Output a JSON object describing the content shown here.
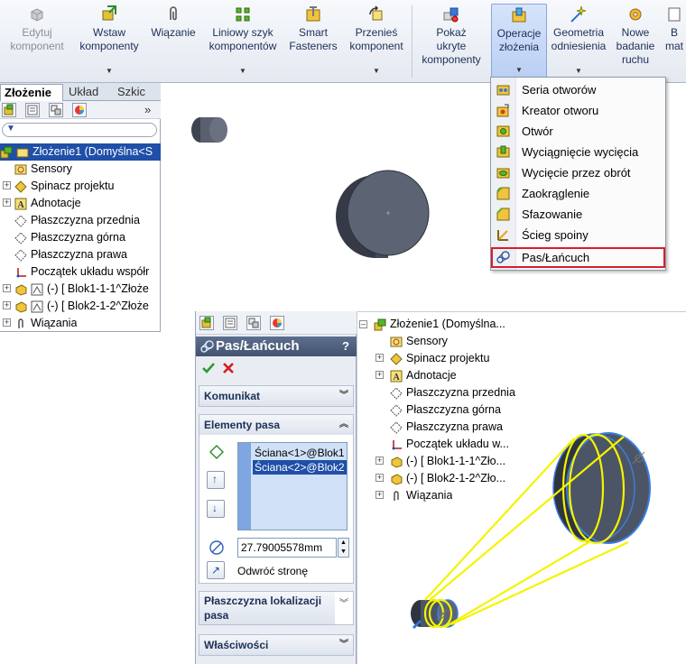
{
  "ribbon": {
    "buttons": [
      {
        "label1": "Edytuj",
        "label2": "komponent",
        "icon": "edit-component-icon",
        "disabled": true
      },
      {
        "label1": "Wstaw",
        "label2": "komponenty",
        "icon": "insert-components-icon"
      },
      {
        "label1": "Wiązanie",
        "label2": "",
        "icon": "mate-icon"
      },
      {
        "label1": "Liniowy szyk",
        "label2": "komponentów",
        "icon": "linear-pattern-icon"
      },
      {
        "label1": "Smart",
        "label2": "Fasteners",
        "icon": "smart-fasteners-icon"
      },
      {
        "label1": "Przenieś",
        "label2": "komponent",
        "icon": "move-component-icon"
      },
      {
        "label1": "Pokaż",
        "label2": "ukryte",
        "label3": "komponenty",
        "icon": "show-hidden-icon"
      },
      {
        "label1": "Operacje",
        "label2": "złożenia",
        "icon": "assembly-features-icon"
      },
      {
        "label1": "Geometria",
        "label2": "odniesienia",
        "icon": "reference-geometry-icon"
      },
      {
        "label1": "Nowe",
        "label2": "badanie",
        "label3": "ruchu",
        "icon": "new-motion-study-icon"
      },
      {
        "label1": "B",
        "label2": "mat",
        "icon": "bill-of-materials-icon"
      }
    ]
  },
  "left_panel": {
    "tabs": [
      "Złożenie",
      "Układ",
      "Szkic"
    ],
    "expand_glyph": "»",
    "tree": [
      {
        "label": "Złożenie1  (Domyślna<S",
        "selected": true
      },
      {
        "label": "Sensory"
      },
      {
        "label": "Spinacz projektu"
      },
      {
        "label": "Adnotacje"
      },
      {
        "label": "Płaszczyzna przednia"
      },
      {
        "label": "Płaszczyzna górna"
      },
      {
        "label": "Płaszczyzna prawa"
      },
      {
        "label": "Początek układu współr"
      },
      {
        "label": "(-) [ Blok1-1-1^Złoże"
      },
      {
        "label": "(-) [ Blok2-1-2^Złoże"
      },
      {
        "label": "Wiązania"
      }
    ]
  },
  "dropdown_menu": {
    "items": [
      {
        "label": "Seria otworów",
        "icon": "hole-series-icon"
      },
      {
        "label": "Kreator otworu",
        "icon": "hole-wizard-icon"
      },
      {
        "label": "Otwór",
        "icon": "hole-icon"
      },
      {
        "label": "Wyciągnięcie wycięcia",
        "icon": "extruded-cut-icon"
      },
      {
        "label": "Wycięcie przez obrót",
        "icon": "revolved-cut-icon"
      },
      {
        "label": "Zaokrąglenie",
        "icon": "fillet-icon"
      },
      {
        "label": "Sfazowanie",
        "icon": "chamfer-icon"
      },
      {
        "label": "Ścieg spoiny",
        "icon": "weld-bead-icon"
      },
      {
        "label": "Pas/Łańcuch",
        "icon": "belt-chain-icon",
        "highlighted": true
      }
    ]
  },
  "property_manager": {
    "title": "Pas/Łańcuch",
    "help": "?",
    "groups": {
      "message": "Komunikat",
      "belt_members": "Elementy pasa",
      "belt_plane": "Płaszczyzna lokalizacji pasa",
      "properties": "Właściwości"
    },
    "belt_items": [
      "Ściana<1>@Blok1",
      "Ściana<2>@Blok2"
    ],
    "length_value": "27.79005578mm",
    "reverse_label": "Odwróć stronę"
  },
  "right_tree": [
    {
      "label": "Złożenie1  (Domyślna..."
    },
    {
      "label": "Sensory"
    },
    {
      "label": "Spinacz projektu"
    },
    {
      "label": "Adnotacje"
    },
    {
      "label": "Płaszczyzna przednia"
    },
    {
      "label": "Płaszczyzna górna"
    },
    {
      "label": "Płaszczyzna prawa"
    },
    {
      "label": "Początek układu w..."
    },
    {
      "label": "(-) [ Blok1-1-1^Zło..."
    },
    {
      "label": "(-) [ Blok2-1-2^Zło..."
    },
    {
      "label": "Wiązania"
    }
  ],
  "colors": {
    "selection": "#1f4fa8",
    "belt": "#f4f400",
    "cylinder": "#4d5564",
    "highlight_box": "#d81e2a"
  }
}
